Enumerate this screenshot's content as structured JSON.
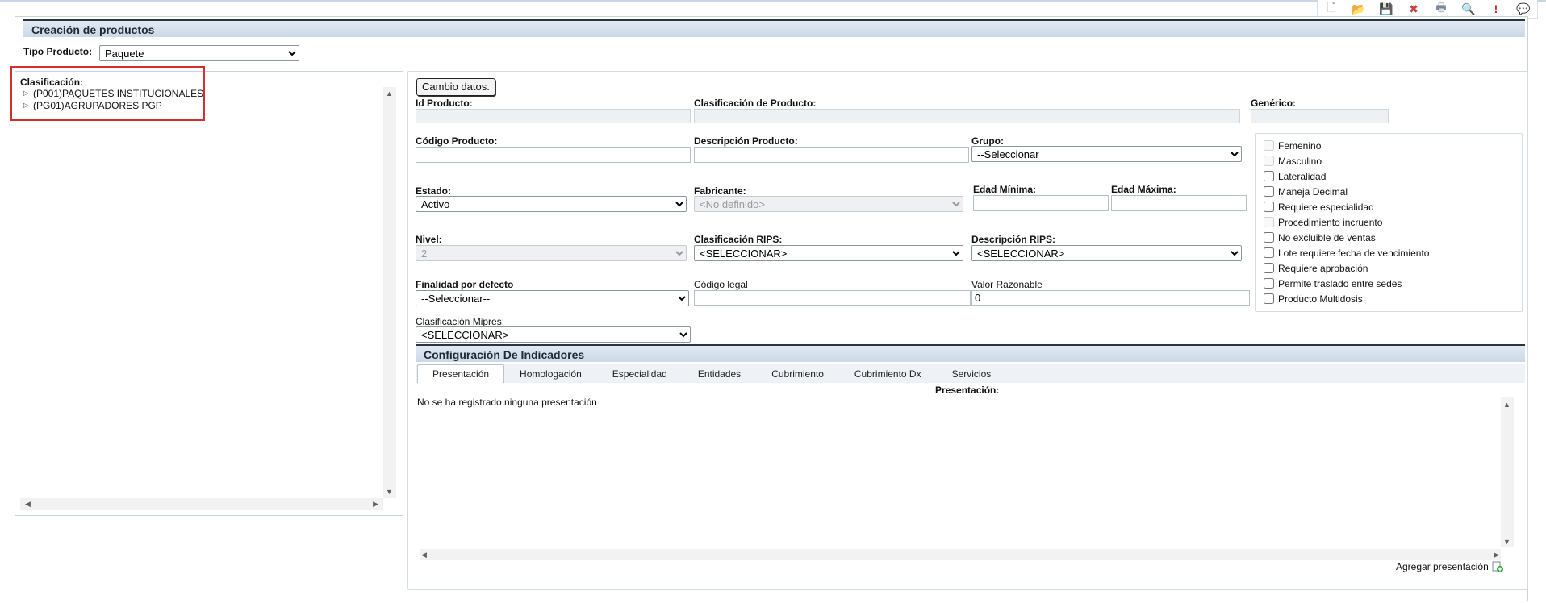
{
  "toolbar": {
    "icons": [
      "new-document-icon",
      "folder-icon",
      "save-icon",
      "delete-icon",
      "print-icon",
      "search-icon",
      "alert-icon",
      "comment-icon"
    ],
    "glyphs": {
      "new": "🗋",
      "open": "📂",
      "save": "💾",
      "delete": "✖",
      "print": "🖶",
      "find": "🔍",
      "alert": "!",
      "chat": "💬"
    }
  },
  "header": {
    "title": "Creación de productos"
  },
  "tipo_producto": {
    "label": "Tipo Producto:",
    "value": "Paquete"
  },
  "clasificacion": {
    "label": "Clasificación:",
    "items": [
      {
        "label": "(P001)PAQUETES INSTITUCIONALES"
      },
      {
        "label": "(PG01)AGRUPADORES PGP"
      }
    ]
  },
  "form": {
    "cambio_button": "Cambio datos.",
    "id_producto": {
      "label": "Id Producto:",
      "value": ""
    },
    "clasificacion_producto": {
      "label": "Clasificación de Producto:",
      "value": ""
    },
    "generico": {
      "label": "Genérico:",
      "value": ""
    },
    "codigo_producto": {
      "label": "Código Producto:",
      "value": ""
    },
    "descripcion_producto": {
      "label": "Descripción Producto:",
      "value": ""
    },
    "grupo": {
      "label": "Grupo:",
      "value": "--Seleccionar"
    },
    "estado": {
      "label": "Estado:",
      "value": "Activo"
    },
    "fabricante": {
      "label": "Fabricante:",
      "value": "<No definido>"
    },
    "edad_minima": {
      "label": "Edad Mínima:",
      "value": ""
    },
    "edad_maxima": {
      "label": "Edad Máxima:",
      "value": ""
    },
    "nivel": {
      "label": "Nivel:",
      "value": "2"
    },
    "clasificacion_rips": {
      "label": "Clasificación RIPS:",
      "value": "<SELECCIONAR>"
    },
    "descripcion_rips": {
      "label": "Descripción RIPS:",
      "value": "<SELECCIONAR>"
    },
    "finalidad": {
      "label": "Finalidad por defecto",
      "value": "--Seleccionar--"
    },
    "codigo_legal": {
      "label": "Código legal",
      "value": ""
    },
    "valor_razonable": {
      "label": "Valor Razonable",
      "value": "0"
    },
    "clasificacion_mipres": {
      "label": "Clasificación Mipres:",
      "value": "<SELECCIONAR>"
    }
  },
  "checkboxes": [
    {
      "label": "Femenino",
      "checked": false,
      "disabled": true
    },
    {
      "label": "Masculino",
      "checked": false,
      "disabled": true
    },
    {
      "label": "Lateralidad",
      "checked": false,
      "disabled": false
    },
    {
      "label": "Maneja Decimal",
      "checked": false,
      "disabled": false
    },
    {
      "label": "Requiere especialidad",
      "checked": false,
      "disabled": false
    },
    {
      "label": "Procedimiento incruento",
      "checked": false,
      "disabled": true
    },
    {
      "label": "No excluible de ventas",
      "checked": false,
      "disabled": false
    },
    {
      "label": "Lote requiere fecha de vencimiento",
      "checked": false,
      "disabled": false
    },
    {
      "label": "Requiere aprobación",
      "checked": false,
      "disabled": false
    },
    {
      "label": "Permite traslado entre sedes",
      "checked": false,
      "disabled": false
    },
    {
      "label": "Producto Multidosis",
      "checked": false,
      "disabled": false
    }
  ],
  "indicadores": {
    "title": "Configuración De Indicadores",
    "tabs": [
      {
        "label": "Presentación",
        "active": true
      },
      {
        "label": "Homologación",
        "active": false
      },
      {
        "label": "Especialidad",
        "active": false
      },
      {
        "label": "Entidades",
        "active": false
      },
      {
        "label": "Cubrimiento",
        "active": false
      },
      {
        "label": "Cubrimiento Dx",
        "active": false
      },
      {
        "label": "Servicios",
        "active": false
      }
    ],
    "presentacion_title": "Presentación:",
    "empty_message": "No se ha registrado ninguna presentación",
    "add_label": "Agregar presentación"
  },
  "colors": {
    "header_bg": "#cbd8e6",
    "highlight_border": "#d32f2f",
    "title_rule": "#2b3540"
  }
}
